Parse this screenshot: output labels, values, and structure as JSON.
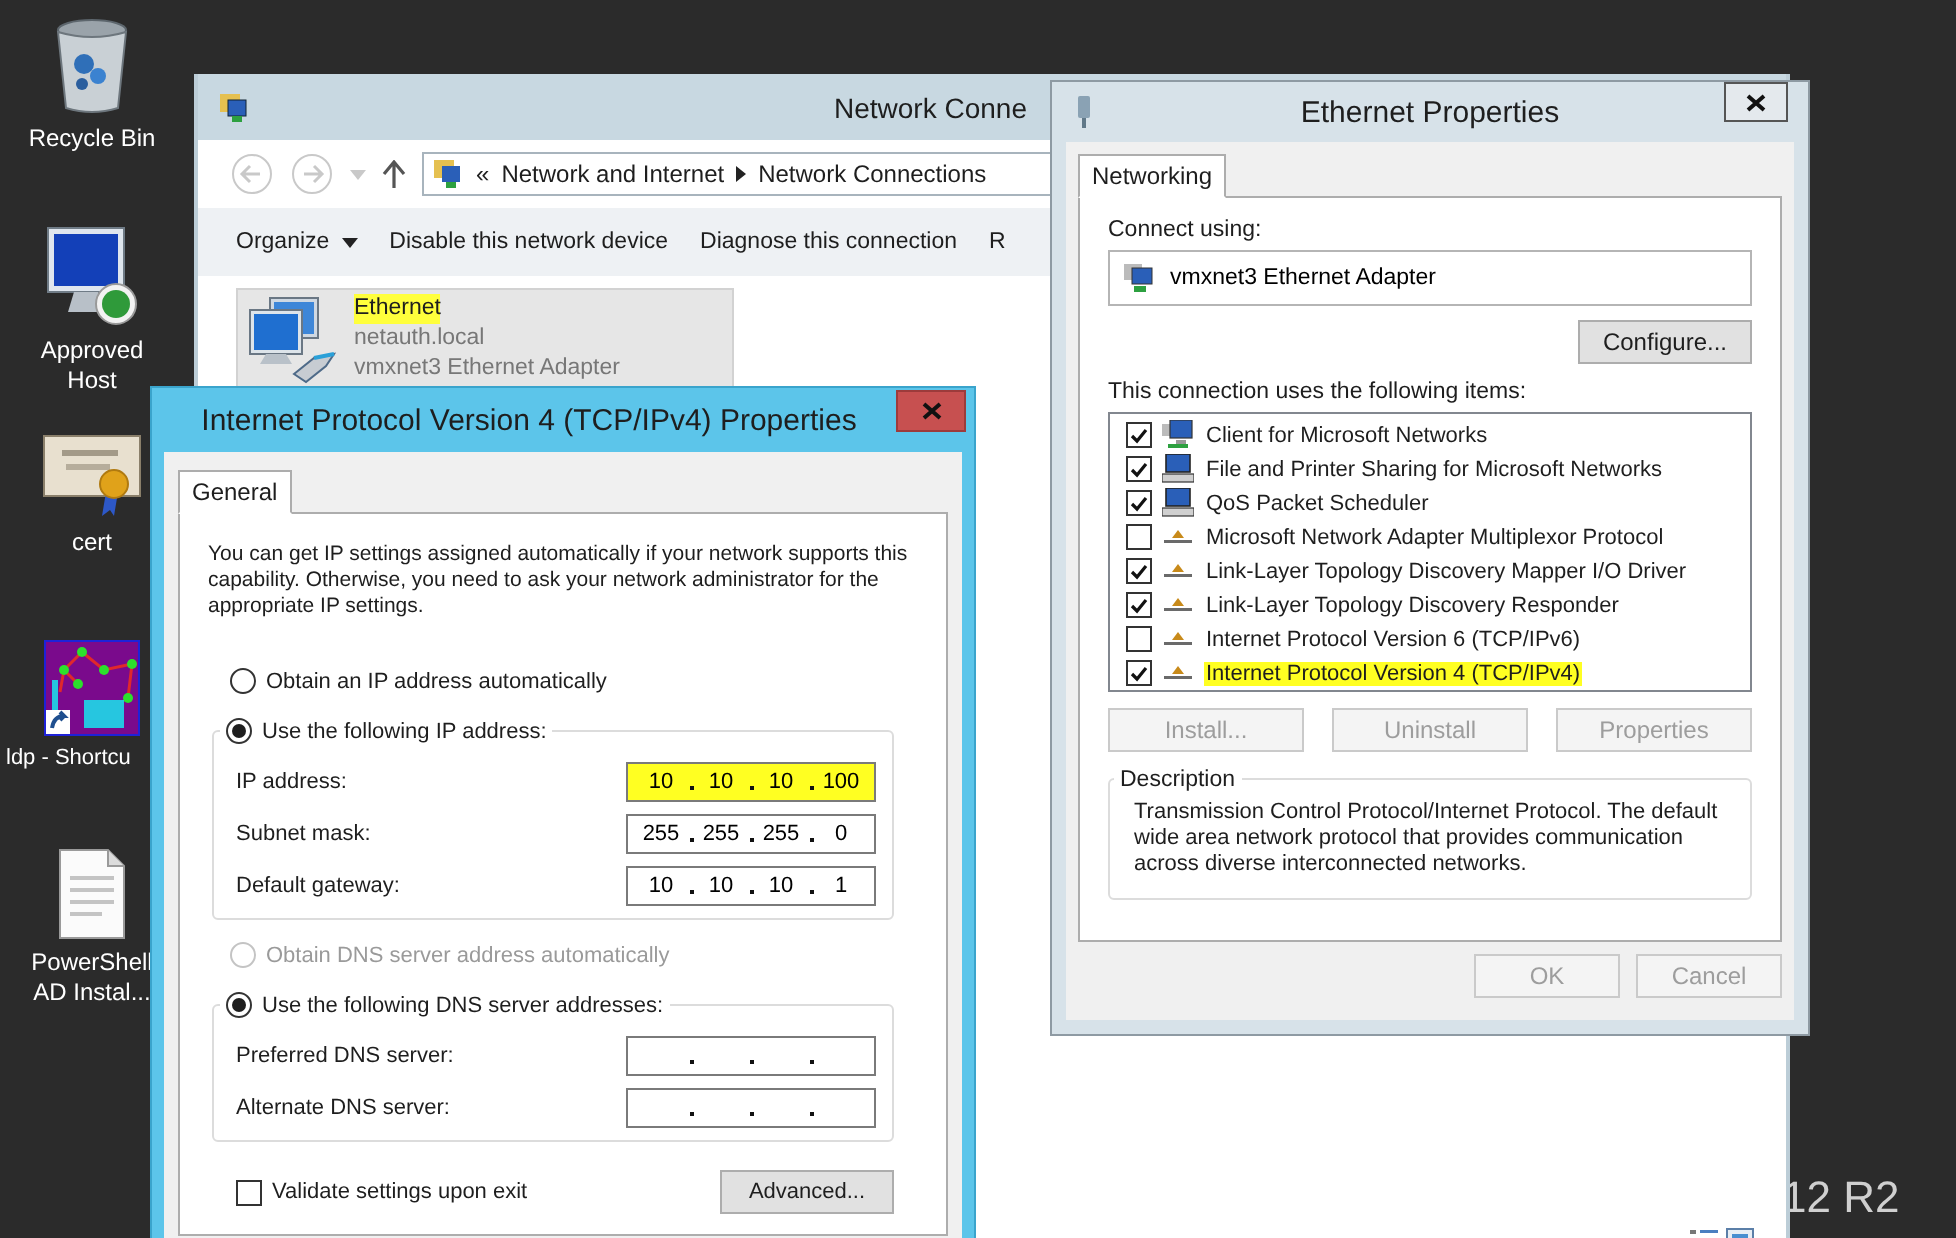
{
  "desktop": {
    "icons": [
      {
        "kind": "recycle_bin",
        "label": "Recycle Bin"
      },
      {
        "kind": "remote_host",
        "label": "Approved Host"
      },
      {
        "kind": "certificate",
        "label": "cert"
      },
      {
        "kind": "ldp_shortcut",
        "label": "ldp - Shortcu"
      },
      {
        "kind": "document",
        "label": "PowerShell AD Instal..."
      }
    ],
    "edition_text": "12 R2"
  },
  "network_connections": {
    "title": "Network Conne",
    "breadcrumb_prefix": "«",
    "breadcrumb": [
      "Network and Internet",
      "Network Connections"
    ],
    "toolbar": [
      {
        "label": "Organize",
        "has_menu": true
      },
      {
        "label": "Disable this network device",
        "has_menu": false
      },
      {
        "label": "Diagnose this connection",
        "has_menu": false
      },
      {
        "label": "R",
        "has_menu": false
      }
    ],
    "connection": {
      "name": "Ethernet",
      "name_highlighted": true,
      "domain": "netauth.local",
      "adapter": "vmxnet3 Ethernet Adapter",
      "selected": true
    }
  },
  "ipv4_dialog": {
    "title": "Internet Protocol Version 4 (TCP/IPv4) Properties",
    "tabs": [
      {
        "label": "General",
        "selected": true
      }
    ],
    "intro": "You can get IP settings assigned automatically if your network supports this capability. Otherwise, you need to ask your network administrator for the appropriate IP settings.",
    "ip_options": [
      {
        "label": "Obtain an IP address automatically",
        "selected": false,
        "disabled": false
      },
      {
        "label": "Use the following IP address:",
        "selected": true,
        "disabled": false
      }
    ],
    "ip_fields": [
      {
        "label": "IP address:",
        "octets": [
          "10",
          "10",
          "10",
          "100"
        ],
        "highlighted": true
      },
      {
        "label": "Subnet mask:",
        "octets": [
          "255",
          "255",
          "255",
          "0"
        ],
        "highlighted": false
      },
      {
        "label": "Default gateway:",
        "octets": [
          "10",
          "10",
          "10",
          "1"
        ],
        "highlighted": false
      }
    ],
    "dns_options": [
      {
        "label": "Obtain DNS server address automatically",
        "selected": false,
        "disabled": true
      },
      {
        "label": "Use the following DNS server addresses:",
        "selected": true,
        "disabled": false
      }
    ],
    "dns_fields": [
      {
        "label": "Preferred DNS server:",
        "highlighted": false
      },
      {
        "label": "Alternate DNS server:",
        "highlighted": false
      }
    ],
    "validate": {
      "label": "Validate settings upon exit",
      "checked": false
    },
    "advanced_button": "Advanced..."
  },
  "ethernet_properties": {
    "title": "Ethernet Properties",
    "tabs": [
      {
        "label": "Networking",
        "selected": true
      }
    ],
    "connect_using_label": "Connect using:",
    "adapter": "vmxnet3 Ethernet Adapter",
    "configure_button": {
      "label": "Configure...",
      "disabled": false
    },
    "items_label": "This connection uses the following items:",
    "items": [
      {
        "kind": "client",
        "label": "Client for Microsoft Networks",
        "checked": true,
        "highlighted": false
      },
      {
        "kind": "service",
        "label": "File and Printer Sharing for Microsoft Networks",
        "checked": true,
        "highlighted": false
      },
      {
        "kind": "service",
        "label": "QoS Packet Scheduler",
        "checked": true,
        "highlighted": false
      },
      {
        "kind": "protocol",
        "label": "Microsoft Network Adapter Multiplexor Protocol",
        "checked": false,
        "highlighted": false
      },
      {
        "kind": "protocol",
        "label": "Link-Layer Topology Discovery Mapper I/O Driver",
        "checked": true,
        "highlighted": false
      },
      {
        "kind": "protocol",
        "label": "Link-Layer Topology Discovery Responder",
        "checked": true,
        "highlighted": false
      },
      {
        "kind": "protocol",
        "label": "Internet Protocol Version 6 (TCP/IPv6)",
        "checked": false,
        "highlighted": false
      },
      {
        "kind": "protocol",
        "label": "Internet Protocol Version 4 (TCP/IPv4)",
        "checked": true,
        "highlighted": true
      }
    ],
    "item_buttons": [
      {
        "label": "Install...",
        "disabled": true
      },
      {
        "label": "Uninstall",
        "disabled": true
      },
      {
        "label": "Properties",
        "disabled": true
      }
    ],
    "description_title": "Description",
    "description": "Transmission Control Protocol/Internet Protocol. The default wide area network protocol that provides communication across diverse interconnected networks.",
    "footer_buttons": [
      {
        "label": "OK",
        "disabled": true
      },
      {
        "label": "Cancel",
        "disabled": true
      }
    ]
  }
}
